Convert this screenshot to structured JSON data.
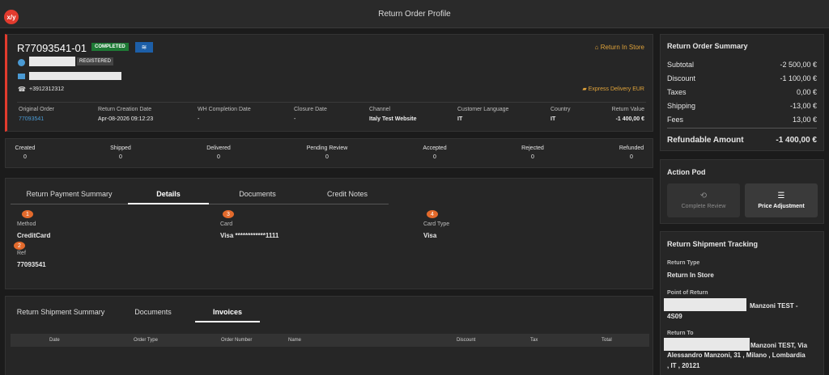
{
  "app": {
    "logo": "x/y",
    "title": "Return Order Profile"
  },
  "order": {
    "id": "R77093541-01",
    "status": "COMPLETED",
    "customer_status": "REGISTERED",
    "phone": "+3912312312",
    "return_type_link": "Return In Store",
    "delivery": "Express Delivery EUR",
    "info": [
      {
        "label": "Original Order",
        "value": "77093541"
      },
      {
        "label": "Return Creation Date",
        "value": "Apr-08-2026 09:12:23"
      },
      {
        "label": "WH Completion Date",
        "value": "-"
      },
      {
        "label": "Closure Date",
        "value": "-"
      },
      {
        "label": "Channel",
        "value": "Italy Test Website"
      },
      {
        "label": "Customer Language",
        "value": "IT"
      },
      {
        "label": "Country",
        "value": "IT"
      },
      {
        "label": "Return Value",
        "value": "-1 400,00 €"
      }
    ]
  },
  "stats": [
    {
      "label": "Created",
      "value": "0"
    },
    {
      "label": "Shipped",
      "value": "0"
    },
    {
      "label": "Delivered",
      "value": "0"
    },
    {
      "label": "Pending Review",
      "value": "0"
    },
    {
      "label": "Accepted",
      "value": "0"
    },
    {
      "label": "Rejected",
      "value": "0"
    },
    {
      "label": "Refunded",
      "value": "0"
    }
  ],
  "payment": {
    "tabs": [
      "Return Payment Summary",
      "Details",
      "Documents",
      "Credit Notes"
    ],
    "fields": [
      {
        "num": "1",
        "label": "Method",
        "value": "CreditCard"
      },
      {
        "num": "2",
        "label": "Ref",
        "value": "77093541"
      },
      {
        "num": "3",
        "label": "Card",
        "value": "Visa ************1111"
      },
      {
        "num": "4",
        "label": "Card Type",
        "value": "Visa"
      }
    ]
  },
  "shipment": {
    "tabs": [
      "Return Shipment Summary",
      "Documents",
      "Invoices"
    ],
    "columns": [
      "Date",
      "Order Type",
      "Order Number",
      "Name",
      "Discount",
      "Tax",
      "Total"
    ]
  },
  "summary": {
    "title": "Return Order Summary",
    "rows": [
      {
        "label": "Subtotal",
        "value": "-2 500,00 €"
      },
      {
        "label": "Discount",
        "value": "-1 100,00 €"
      },
      {
        "label": "Taxes",
        "value": "0,00 €"
      },
      {
        "label": "Shipping",
        "value": "-13,00 €"
      },
      {
        "label": "Fees",
        "value": "13,00 €"
      }
    ],
    "refund_label": "Refundable Amount",
    "refund_value": "-1 400,00 €"
  },
  "pod": {
    "title": "Action Pod",
    "complete": "Complete Review",
    "adjust": "Price Adjustment"
  },
  "tracking": {
    "title": "Return Shipment Tracking",
    "type_label": "Return Type",
    "type_value": "Return In Store",
    "point_label": "Point of Return",
    "point_value_a": "Manzoni TEST -",
    "point_value_b": "4S09",
    "to_label": "Return To",
    "to_value_a": "Manzoni TEST, Via",
    "to_value_b": "Alessandro Manzoni, 31 , Milano , Lombardia",
    "to_value_c": ", IT , 20121"
  },
  "colors": {
    "accent": "#e23b2e",
    "status_green": "#1e7a35",
    "link": "#4a9ad4",
    "warn": "#e0a33a"
  }
}
